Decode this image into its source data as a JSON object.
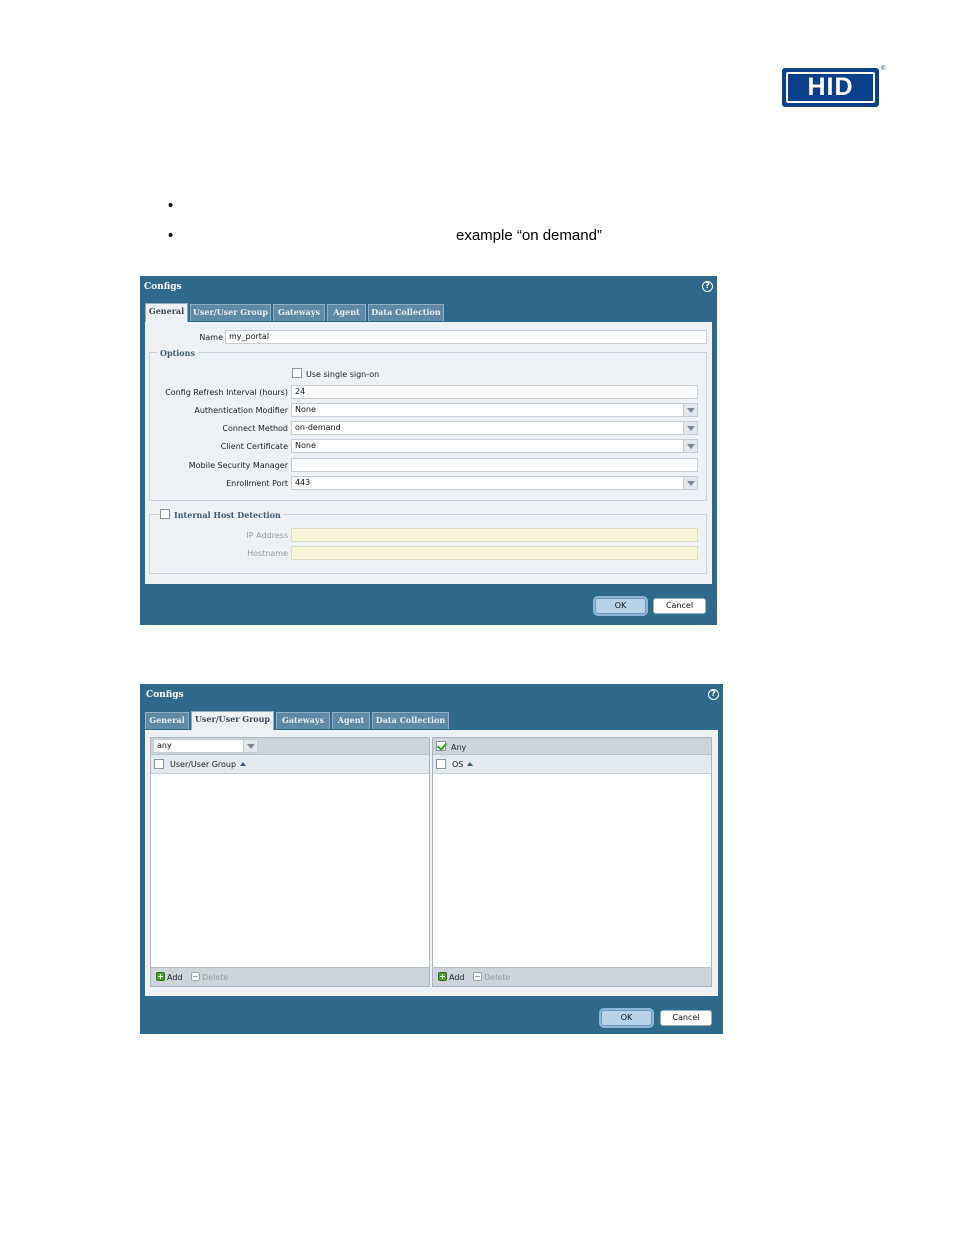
{
  "logo": {
    "text": "HID",
    "reg": "®"
  },
  "bullets": [
    {
      "mark": "•",
      "text": ""
    },
    {
      "mark": "•",
      "text": "example “on demand”"
    }
  ],
  "dialog1": {
    "title": "Configs",
    "help": "?",
    "tabs": [
      "General",
      "User/User Group",
      "Gateways",
      "Agent",
      "Data Collection"
    ],
    "name_label": "Name",
    "name_value": "my_portal",
    "options_legend": "Options",
    "sso_label": "Use single sign-on",
    "refresh_label": "Config Refresh Interval (hours)",
    "refresh_value": "24",
    "auth_label": "Authentication Modifier",
    "auth_value": "None",
    "connect_label": "Connect Method",
    "connect_value": "on-demand",
    "cert_label": "Client Certificate",
    "cert_value": "None",
    "msm_label": "Mobile Security Manager",
    "msm_value": "",
    "port_label": "Enrollment Port",
    "port_value": "443",
    "ihd_legend": "Internal Host Detection",
    "ip_label": "IP Address",
    "host_label": "Hostname",
    "ok": "OK",
    "cancel": "Cancel"
  },
  "dialog2": {
    "title": "Configs",
    "help": "?",
    "tabs": [
      "General",
      "User/User Group",
      "Gateways",
      "Agent",
      "Data Collection"
    ],
    "user_filter": "any",
    "user_header": "User/User Group",
    "any_label": "Any",
    "os_header": "OS",
    "add": "Add",
    "delete": "Delete",
    "ok": "OK",
    "cancel": "Cancel"
  },
  "colors": {
    "dialog_bg": "#2f6a8c",
    "panel_bg": "#eef1f4",
    "logo_blue": "#0b3f8a"
  }
}
